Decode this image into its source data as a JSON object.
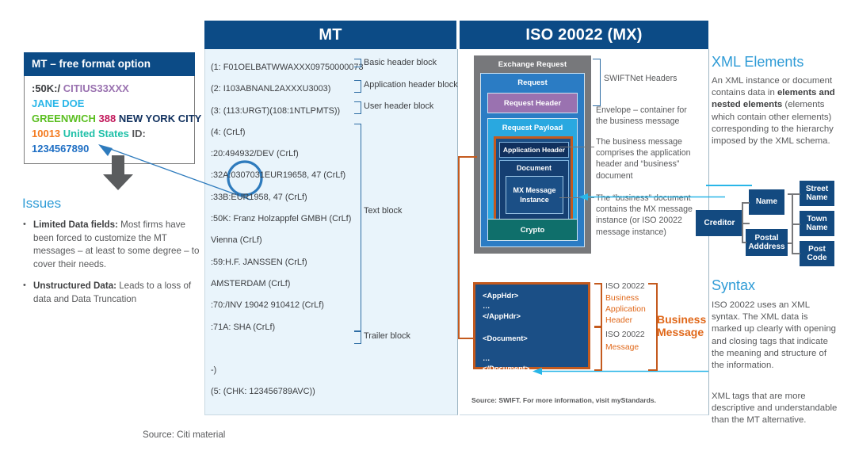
{
  "columns": {
    "mt_header": "MT",
    "iso_header": "ISO 20022 (MX)"
  },
  "mt_box": {
    "title": "MT – free format option",
    "lines": [
      [
        {
          "t": ":50K:/ ",
          "c": "#3b3d40"
        },
        {
          "t": "CITIUS33XXX",
          "c": "#9a72b0"
        }
      ],
      [
        {
          "t": "JANE DOE",
          "c": "#29b6e8"
        }
      ],
      [
        {
          "t": "GREENWICH ",
          "c": "#5bbf21"
        },
        {
          "t": "388 ",
          "c": "#c2185b"
        },
        {
          "t": "NEW YORK CITY",
          "c": "#10305e"
        }
      ],
      [
        {
          "t": "10013 ",
          "c": "#f47b20"
        },
        {
          "t": "United States ",
          "c": "#1fc0a8"
        },
        {
          "t": "ID:",
          "c": "#58595b"
        }
      ],
      [
        {
          "t": "1234567890",
          "c": "#1f6fc4"
        }
      ]
    ]
  },
  "issues": {
    "title": "Issues",
    "items": [
      {
        "lead": "Limited Data fields:",
        "text": " Most firms have been forced to customize the MT messages – at least to some degree – to cover their needs."
      },
      {
        "lead": "Unstructured Data:",
        "text": " Leads to a loss of data and Data Truncation"
      }
    ]
  },
  "mt_message": {
    "lines": [
      "(1: F01OELBATWWAXXX09750000073",
      "(2: I103ABNANL2AXXXU3003)",
      "(3: (113:URGT)(108:1NTLPMTS))",
      "(4: (CrLf)",
      ":20:494932/DEV (CrLf)",
      ":32A:0307031EUR19658, 47 (CrLf)",
      ":33B:EUR1958, 47 (CrLf)",
      ":50K: Franz Holzappfel GMBH (CrLf)",
      "Vienna (CrLf)",
      ":59:H.F. JANSSEN (CrLf)",
      "AMSTERDAM (CrLf)",
      ":70:/INV 19042 910412 (CrLf)",
      ":71A: SHA (CrLf)",
      "",
      "-)",
      "(5: (CHK: 123456789AVC))"
    ],
    "block_labels": [
      "Basic header block",
      "Application header block",
      "User header block",
      "Text block",
      "Trailer block"
    ]
  },
  "iso_diagram": {
    "exchange_request": "Exchange Request",
    "request": "Request",
    "request_header": "Request Header",
    "request_payload": "Request Payload",
    "application_header": "Application Header",
    "document": "Document",
    "mx_message_instance": "MX Message Instance",
    "crypto": "Crypto",
    "notes": [
      "SWIFTNet Headers",
      "Envelope – container for the business message",
      "The business message comprises the application header and “business” document",
      "The “business” document contains the MX message instance (or ISO 20022 message instance)"
    ]
  },
  "xml_block": {
    "apphdr_open": "<AppHdr>",
    "ellipsis": "…",
    "apphdr_close": "</AppHdr>",
    "document_open": "<Document>",
    "document_close": "</Document>",
    "label_bah_gray": "ISO 20022",
    "label_bah_orange": "Business Application Header",
    "label_msg_gray": "ISO 20022",
    "label_msg_orange": "Message",
    "business_message": "Business Message",
    "source": "Source: SWIFT. For more information, visit myStandards."
  },
  "right_column": {
    "xml_elements": {
      "title": "XML Elements",
      "pre": "An XML instance or document contains data in ",
      "bold": "elements and nested elements",
      "post": " (elements which contain other elements) corresponding to the hierarchy imposed by the XML schema."
    },
    "tree": {
      "root": "Creditor",
      "level2": [
        "Name",
        "Postal Adddress"
      ],
      "level3": [
        "Street Name",
        "Town Name",
        "Post Code"
      ]
    },
    "syntax": {
      "title": "Syntax",
      "p1": "ISO 20022 uses an XML syntax. The XML data is marked up clearly with opening and closing tags that indicate the meaning and structure of the information.",
      "p2": "XML tags that are more descriptive and understandable than the MT alternative."
    }
  },
  "bottom_source": "Source: Citi material",
  "colors": {
    "navy": "#0c4b86",
    "accent_blue": "#2e9bd6",
    "orange": "#c45a1e",
    "orange_text": "#e0681a",
    "panel_bg": "#e9f4fb",
    "gray_text": "#58595b",
    "cyan": "#29b6e8"
  }
}
